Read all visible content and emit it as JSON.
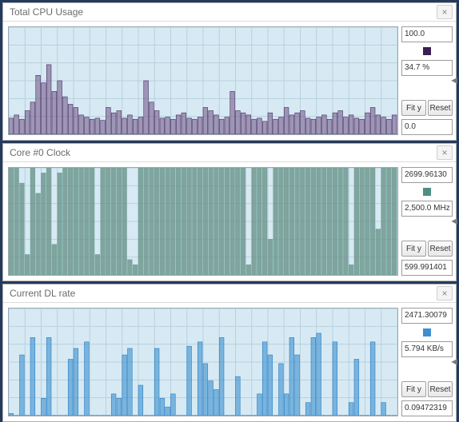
{
  "panels": [
    {
      "id": "cpu",
      "title": "Total CPU Usage",
      "bg": "#d7eaf4",
      "barFill": "rgba(110,80,130,0.55)",
      "barStroke": "#4a2a63",
      "swatch": "#3b1e52",
      "max_label": "100.0",
      "cur_label": "34.7 %",
      "min_label": "0.0",
      "fit_label": "Fit y",
      "reset_label": "Reset",
      "yscale": 100
    },
    {
      "id": "clock",
      "title": "Core #0 Clock",
      "bg": "#d7eaf4",
      "barFill": "rgba(100,140,130,0.75)",
      "barStroke": "#6fa79c",
      "swatch": "#4f8f83",
      "max_label": "2699.96130",
      "cur_label": "2,500.0 MHz",
      "min_label": "599.991401",
      "fit_label": "Fit y",
      "reset_label": "Reset",
      "yscale": 2700,
      "ymin": 600
    },
    {
      "id": "dl",
      "title": "Current DL rate",
      "bg": "#d7eaf4",
      "barFill": "rgba(70,150,210,0.65)",
      "barStroke": "#2d7fc1",
      "swatch": "#3d8fd1",
      "max_label": "2471.30079",
      "cur_label": "5.794 KB/s",
      "min_label": "0.09472319",
      "fit_label": "Fit y",
      "reset_label": "Reset",
      "yscale": 2471
    }
  ],
  "chart_data": [
    {
      "type": "bar",
      "title": "Total CPU Usage",
      "ylabel": "%",
      "ylim": [
        0,
        100
      ],
      "values": [
        15,
        18,
        14,
        22,
        30,
        55,
        48,
        65,
        40,
        50,
        35,
        28,
        25,
        18,
        16,
        14,
        15,
        13,
        25,
        20,
        22,
        15,
        18,
        14,
        16,
        50,
        30,
        22,
        15,
        16,
        14,
        18,
        20,
        15,
        14,
        16,
        25,
        22,
        18,
        14,
        16,
        40,
        22,
        20,
        18,
        14,
        15,
        12,
        20,
        14,
        16,
        25,
        18,
        20,
        22,
        15,
        14,
        16,
        18,
        14,
        20,
        22,
        16,
        18,
        15,
        14,
        20,
        25,
        18,
        16,
        14,
        18
      ],
      "current": 34.7
    },
    {
      "type": "bar",
      "title": "Core #0 Clock",
      "ylabel": "MHz",
      "ylim": [
        600,
        2700
      ],
      "values": [
        2700,
        2700,
        2400,
        1000,
        2700,
        2200,
        2600,
        2700,
        1200,
        2600,
        2700,
        2700,
        2700,
        2700,
        2700,
        2700,
        1000,
        2700,
        2700,
        2700,
        2700,
        2700,
        900,
        800,
        2700,
        2700,
        2700,
        2700,
        2700,
        2700,
        2700,
        2700,
        2700,
        2700,
        2700,
        2700,
        2700,
        2700,
        2700,
        2700,
        2700,
        2700,
        2700,
        2700,
        800,
        2700,
        2700,
        2700,
        1300,
        2700,
        2700,
        2700,
        2700,
        2700,
        2700,
        2700,
        2700,
        2700,
        2700,
        2700,
        2700,
        2700,
        2700,
        800,
        2700,
        2700,
        2700,
        2700,
        1500,
        2700,
        2700,
        2700
      ],
      "current": 2500.0
    },
    {
      "type": "bar",
      "title": "Current DL rate",
      "ylabel": "KB/s",
      "ylim": [
        0,
        2471
      ],
      "values": [
        50,
        5,
        1400,
        5,
        1800,
        5,
        400,
        1800,
        5,
        5,
        5,
        1300,
        1550,
        5,
        1700,
        5,
        5,
        5,
        5,
        500,
        400,
        1400,
        1550,
        5,
        700,
        5,
        5,
        1550,
        400,
        200,
        500,
        5,
        5,
        1600,
        5,
        1700,
        1200,
        800,
        600,
        1800,
        5,
        5,
        900,
        5,
        5,
        5,
        500,
        1700,
        1400,
        5,
        1200,
        500,
        1800,
        1400,
        5,
        300,
        1800,
        1900,
        5,
        5,
        1700,
        5,
        5,
        300,
        1300,
        5,
        5,
        1700,
        5,
        300,
        5,
        5
      ],
      "current": 5.794
    }
  ]
}
